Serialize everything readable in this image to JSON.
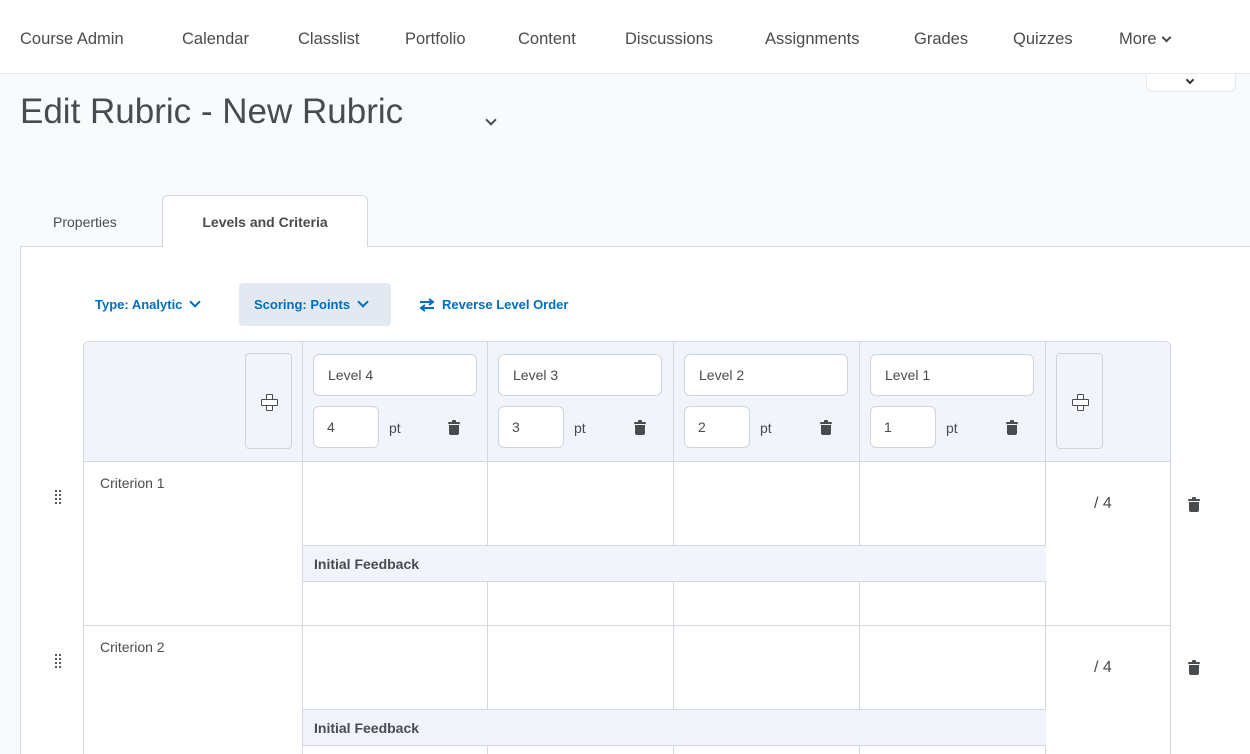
{
  "nav": {
    "items": [
      "Course Admin",
      "Calendar",
      "Classlist",
      "Portfolio",
      "Content",
      "Discussions",
      "Assignments",
      "Grades",
      "Quizzes"
    ],
    "more_label": "More"
  },
  "page": {
    "title": "Edit Rubric - New Rubric"
  },
  "tabs": {
    "properties": "Properties",
    "levels_and_criteria": "Levels and Criteria"
  },
  "toolbar": {
    "type_label": "Type: Analytic",
    "scoring_label": "Scoring: Points",
    "reverse_label": "Reverse Level Order"
  },
  "levels": [
    {
      "name": "Level 4",
      "points": "4",
      "unit": "pt"
    },
    {
      "name": "Level 3",
      "points": "3",
      "unit": "pt"
    },
    {
      "name": "Level 2",
      "points": "2",
      "unit": "pt"
    },
    {
      "name": "Level 1",
      "points": "1",
      "unit": "pt"
    }
  ],
  "criteria": [
    {
      "name": "Criterion 1",
      "out_of": "/ 4",
      "feedback_label": "Initial Feedback"
    },
    {
      "name": "Criterion 2",
      "out_of": "/ 4",
      "feedback_label": "Initial Feedback"
    }
  ],
  "icons": {
    "add_level": "plus-icon",
    "delete": "trash-icon",
    "drag": "drag-handle-icon",
    "reverse": "swap-arrows-icon",
    "dropdown": "chevron-down-icon"
  },
  "colors": {
    "accent": "#006fbf",
    "text": "#494c4e",
    "header_bg": "#f1f5fb",
    "border": "#d3d9e3"
  }
}
